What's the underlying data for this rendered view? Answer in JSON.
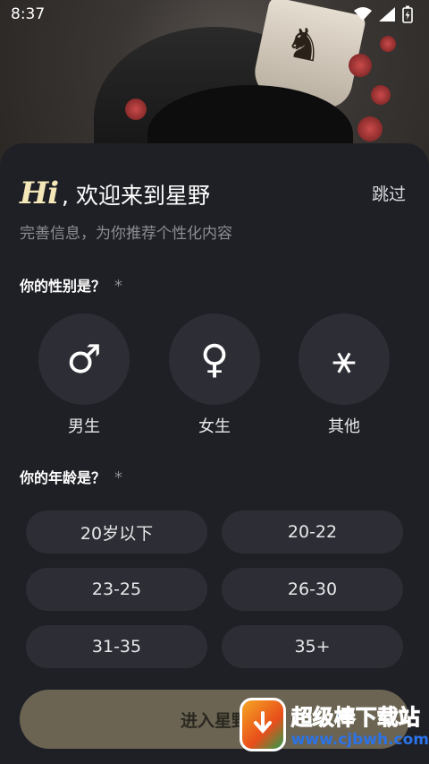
{
  "status_bar": {
    "time": "8:37"
  },
  "header": {
    "hi": "Hi",
    "welcome": ", 欢迎来到星野",
    "skip_label": "跳过",
    "subtitle": "完善信息，为你推荐个性化内容"
  },
  "gender_section": {
    "title": "你的性别是？",
    "required_mark": "*",
    "options": [
      {
        "label": "男生",
        "icon": "male-icon",
        "glyph": "♂"
      },
      {
        "label": "女生",
        "icon": "female-icon",
        "glyph": "♀"
      },
      {
        "label": "其他",
        "icon": "other-gender-icon",
        "glyph": "⚹"
      }
    ]
  },
  "age_section": {
    "title": "你的年龄是？",
    "required_mark": "*",
    "options": [
      "20岁以下",
      "20-22",
      "23-25",
      "26-30",
      "31-35",
      "35+"
    ]
  },
  "enter_button": {
    "label": "进入星野"
  },
  "watermark": {
    "title": "超级棒下载站",
    "url": "www.cjbwh.com"
  },
  "colors": {
    "sheet_bg": "#1f2026",
    "option_bg": "#2d2e35",
    "hi_accent": "#f4e7b8",
    "enter_button_bg": "#6b6452"
  }
}
